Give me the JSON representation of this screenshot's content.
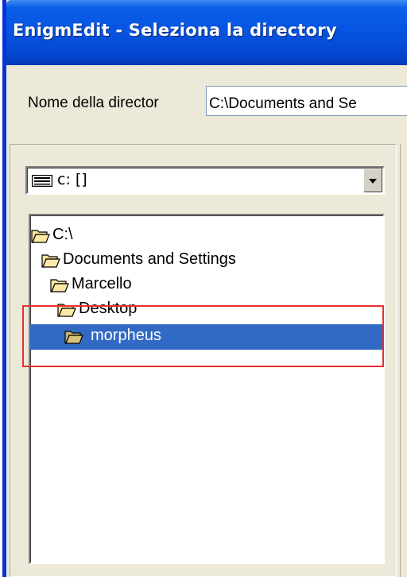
{
  "window": {
    "title": "EnigmEdit - Seleziona la directory"
  },
  "name_row": {
    "label": "Nome della director",
    "value": "C:\\Documents and Se"
  },
  "drive": {
    "label": "c: []",
    "icon": "drive-icon"
  },
  "tree": {
    "items": [
      {
        "label": "C:\\",
        "icon": "folder-open-icon",
        "selected": false
      },
      {
        "label": "Documents and Settings",
        "icon": "folder-open-icon",
        "selected": false
      },
      {
        "label": "Marcello",
        "icon": "folder-open-icon",
        "selected": false
      },
      {
        "label": "Desktop",
        "icon": "folder-open-icon",
        "selected": false
      },
      {
        "label": "morpheus",
        "icon": "folder-open-icon",
        "selected": true
      }
    ]
  },
  "colors": {
    "title_bar": "#0653e0",
    "selection": "#316ac5",
    "annotation": "#e8312f",
    "dialog_bg": "#ece9d8"
  }
}
